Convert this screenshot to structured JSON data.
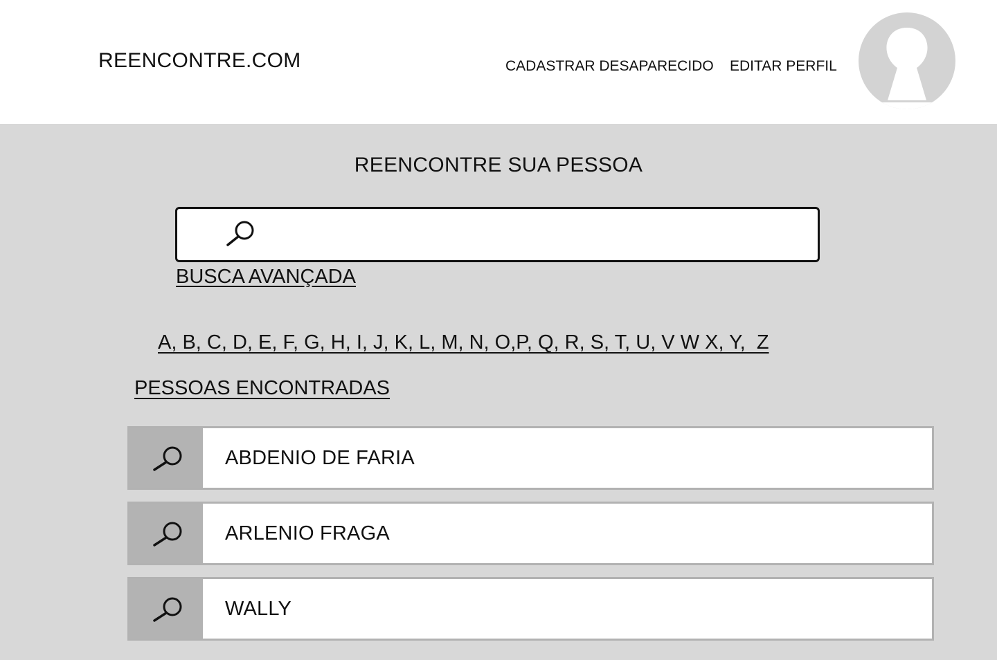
{
  "header": {
    "brand": "REENCONTRE.COM",
    "nav": {
      "register_missing": "CADASTRAR DESAPARECIDO",
      "edit_profile": "EDITAR PERFIL"
    },
    "avatar_icon": "user-avatar-icon"
  },
  "main": {
    "title": "REENCONTRE SUA PESSOA",
    "search": {
      "value": "",
      "placeholder": "",
      "icon": "search-icon"
    },
    "advanced_search": "BUSCA AVANÇADA",
    "alphabet": "A, B, C, D, E, F, G, H, I, J, K, L, M, N, O,P, Q, R, S, T, U, V W X, Y,  Z",
    "results_title": "PESSOAS ENCONTRADAS",
    "results": [
      {
        "name": "ABDENIO DE FARIA"
      },
      {
        "name": "ARLENIO FRAGA"
      },
      {
        "name": "WALLY"
      }
    ]
  },
  "colors": {
    "header_bg": "#ffffff",
    "page_bg": "#d8d8d8",
    "icon_cell_bg": "#b3b3b3",
    "avatar_gray": "#d3d3d3",
    "text": "#111111"
  }
}
